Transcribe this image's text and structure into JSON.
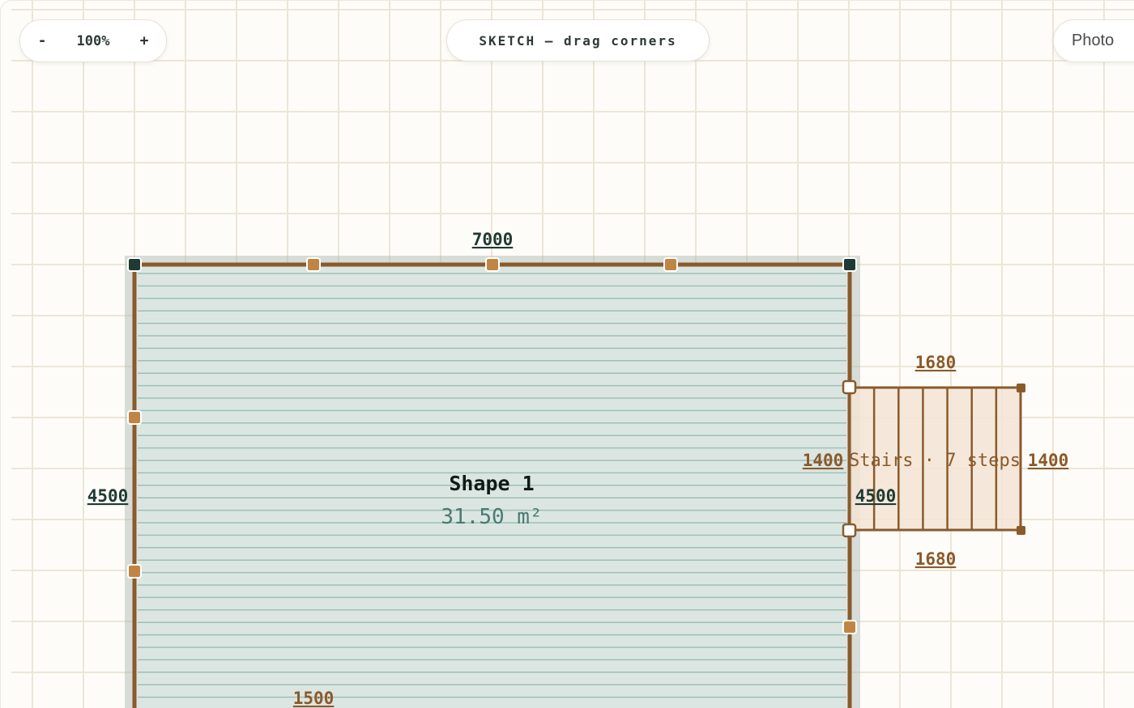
{
  "zoom": {
    "minus_label": "-",
    "level": "100%",
    "plus_label": "+"
  },
  "mode": {
    "label": "SKETCH — drag corners"
  },
  "view_toggle": {
    "photo_label": "Photo"
  },
  "shape": {
    "title": "Shape 1",
    "area": "31.50 m²",
    "dims": {
      "top": "7000",
      "left": "4500",
      "right": "4500",
      "bottom_partial": "1500"
    }
  },
  "stairs": {
    "label": "Stairs · 7 steps",
    "dims": {
      "top": "1680",
      "bottom": "1680",
      "left": "1400",
      "right": "1400"
    },
    "steps": 7
  },
  "colors": {
    "canvas_bg": "#fdfcf8",
    "grid": "#ece6d6",
    "deck_fill": "#dbe6e2",
    "frame": "#8a5a2b",
    "handle_corner": "#1e3a33",
    "handle_mid": "#c08544",
    "stairs_fill": "#f3e4d6"
  }
}
